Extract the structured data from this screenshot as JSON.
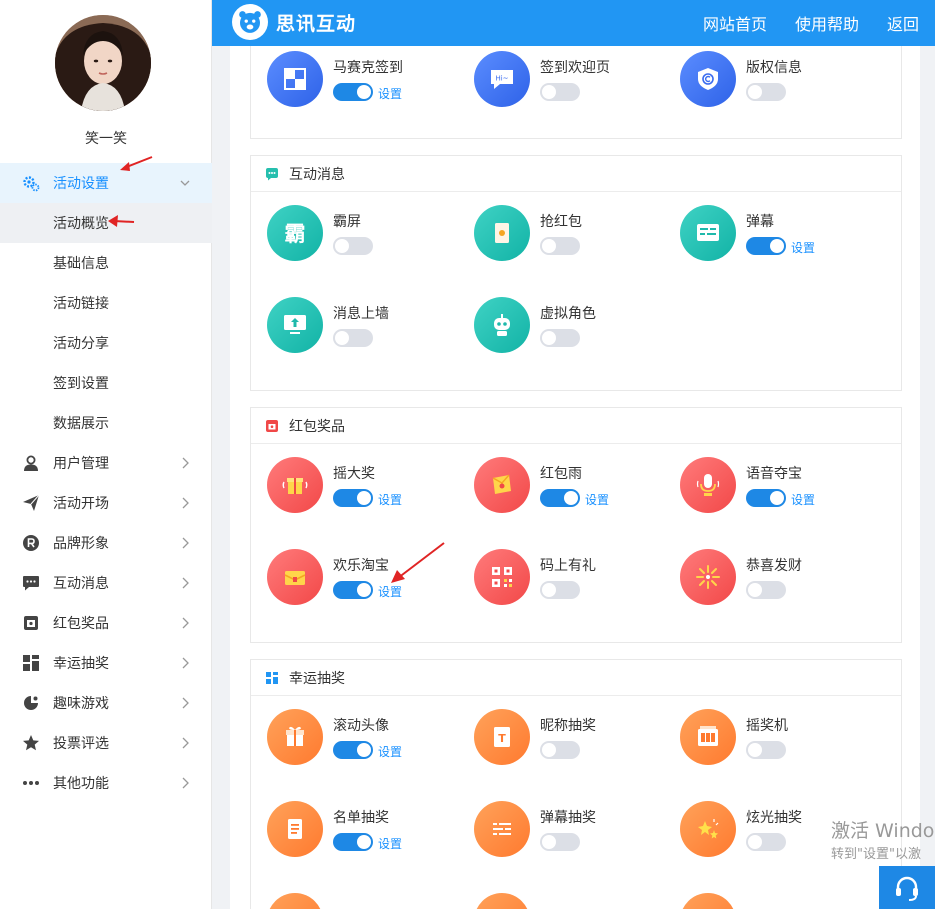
{
  "sidebar": {
    "username": "笑一笑",
    "menu": [
      {
        "label": "活动设置",
        "icon": "gears-icon",
        "expanded": true
      },
      {
        "label": "用户管理",
        "icon": "user-icon"
      },
      {
        "label": "活动开场",
        "icon": "paper-plane-icon"
      },
      {
        "label": "品牌形象",
        "icon": "registered-icon"
      },
      {
        "label": "互动消息",
        "icon": "chat-bubble-icon"
      },
      {
        "label": "红包奖品",
        "icon": "gift-icon"
      },
      {
        "label": "幸运抽奖",
        "icon": "lottery-icon"
      },
      {
        "label": "趣味游戏",
        "icon": "game-icon"
      },
      {
        "label": "投票评选",
        "icon": "star-icon"
      },
      {
        "label": "其他功能",
        "icon": "more-icon"
      }
    ],
    "submenu": [
      "活动概览",
      "基础信息",
      "活动链接",
      "活动分享",
      "签到设置",
      "数据展示"
    ]
  },
  "header": {
    "brand": "思讯互动",
    "links": [
      "网站首页",
      "使用帮助",
      "返回"
    ]
  },
  "common": {
    "settings_label": "设置"
  },
  "sections": [
    {
      "title": "",
      "items": [
        {
          "name": "马赛克签到",
          "enabled": true
        },
        {
          "name": "签到欢迎页",
          "enabled": false
        },
        {
          "name": "版权信息",
          "enabled": false
        }
      ]
    },
    {
      "title": "互动消息",
      "items": [
        {
          "name": "霸屏",
          "enabled": false
        },
        {
          "name": "抢红包",
          "enabled": false
        },
        {
          "name": "弹幕",
          "enabled": true
        },
        {
          "name": "消息上墙",
          "enabled": false
        },
        {
          "name": "虚拟角色",
          "enabled": false
        }
      ]
    },
    {
      "title": "红包奖品",
      "items": [
        {
          "name": "摇大奖",
          "enabled": true
        },
        {
          "name": "红包雨",
          "enabled": true
        },
        {
          "name": "语音夺宝",
          "enabled": true
        },
        {
          "name": "欢乐淘宝",
          "enabled": true
        },
        {
          "name": "码上有礼",
          "enabled": false
        },
        {
          "name": "恭喜发财",
          "enabled": false
        }
      ]
    },
    {
      "title": "幸运抽奖",
      "items": [
        {
          "name": "滚动头像",
          "enabled": true
        },
        {
          "name": "昵称抽奖",
          "enabled": false
        },
        {
          "name": "摇奖机",
          "enabled": false
        },
        {
          "name": "名单抽奖",
          "enabled": true
        },
        {
          "name": "弹幕抽奖",
          "enabled": false
        },
        {
          "name": "炫光抽奖",
          "enabled": false
        }
      ]
    }
  ],
  "watermark": {
    "line1": "激活 Windo",
    "line2": "转到\"设置\"以激"
  },
  "colors": {
    "primary": "#2196f3",
    "toggle_on": "#1e88e5",
    "link": "#1890ff"
  }
}
